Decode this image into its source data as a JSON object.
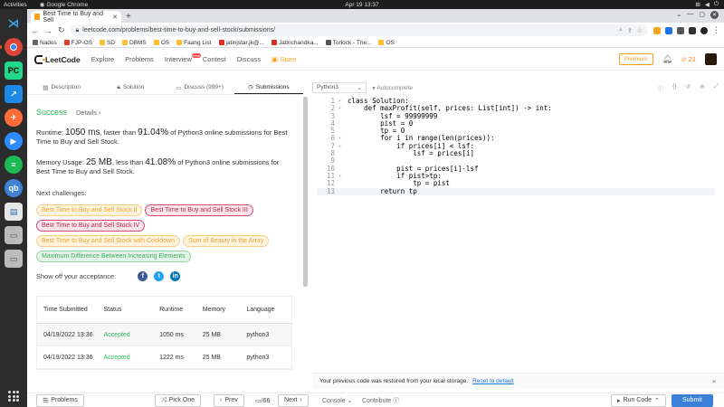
{
  "os": {
    "activities": "Activities",
    "app": "Google Chrome",
    "clock": "Apr 19  13:37"
  },
  "browser": {
    "tab_title": "Best Time to Buy and Sell",
    "url": "leetcode.com/problems/best-time-to-buy-and-sell-stock/submissions/",
    "bookmarks": [
      "Nados",
      "FJP-OS",
      "SD",
      "DBMS",
      "OS",
      "Faang List",
      "jatinjstar.jk@...",
      "Jatinchandka...",
      "Torlock - The...",
      "OS"
    ]
  },
  "nav": {
    "brand": "LeetCode",
    "items": [
      "Explore",
      "Problems",
      "Interview",
      "Contest",
      "Discuss",
      "Store"
    ],
    "new_badge": "New",
    "premium": "Premium",
    "coins": "21"
  },
  "left_tabs": [
    "Description",
    "Solution",
    "Discuss (999+)",
    "Submissions"
  ],
  "result": {
    "status": "Success",
    "details": "Details",
    "runtime_prefix": "Runtime: ",
    "runtime_value": "1050 ms",
    "runtime_mid": ", faster than ",
    "runtime_pct": "91.04%",
    "runtime_suffix": " of Python3 online submissions for Best Time to Buy and Sell Stock.",
    "memory_prefix": "Memory Usage: ",
    "memory_value": "25 MB",
    "memory_mid": ", less than ",
    "memory_pct": "41.08%",
    "memory_suffix": " of Python3 online submissions for Best Time to Buy and Sell Stock."
  },
  "next_label": "Next challenges:",
  "challenges": [
    {
      "label": "Best Time to Buy and Sell Stock II",
      "difficulty": "medium"
    },
    {
      "label": "Best Time to Buy and Sell Stock III",
      "difficulty": "hard"
    },
    {
      "label": "Best Time to Buy and Sell Stock IV",
      "difficulty": "hard"
    },
    {
      "label": "Best Time to Buy and Sell Stock with Cooldown",
      "difficulty": "medium"
    },
    {
      "label": "Sum of Beauty in the Array",
      "difficulty": "medium"
    },
    {
      "label": "Maximum Difference Between Increasing Elements",
      "difficulty": "easy"
    }
  ],
  "share_label": "Show off your acceptance:",
  "table": {
    "headers": [
      "Time Submitted",
      "Status",
      "Runtime",
      "Memory",
      "Language"
    ],
    "rows": [
      [
        "04/19/2022 13:36",
        "Accepted",
        "1050 ms",
        "25 MB",
        "python3"
      ],
      [
        "04/19/2022 13:36",
        "Accepted",
        "1222 ms",
        "25 MB",
        "python3"
      ]
    ]
  },
  "editor": {
    "language": "Python3",
    "autocomplete": "Autocomplete",
    "lines": [
      "class Solution:",
      "    def maxProfit(self, prices: List[int]) -> int:",
      "        lsf = 99999999",
      "        pist = 0",
      "        tp = 0",
      "        for i in range(len(prices)):",
      "            if prices[i] < lsf:",
      "                lsf = prices[i]",
      "",
      "            pist = prices[i]-lsf",
      "            if pist>tp:",
      "                tp = pist",
      "        return tp"
    ],
    "restore_msg": "Your previous code was restored from your local storage.",
    "reset_link": "Reset to default"
  },
  "bottom": {
    "problems": "Problems",
    "pick_one": "Pick One",
    "prev": "Prev",
    "page": "/66",
    "next": "Next",
    "console": "Console",
    "contribute": "Contribute",
    "run": "Run Code",
    "submit": "Submit"
  }
}
